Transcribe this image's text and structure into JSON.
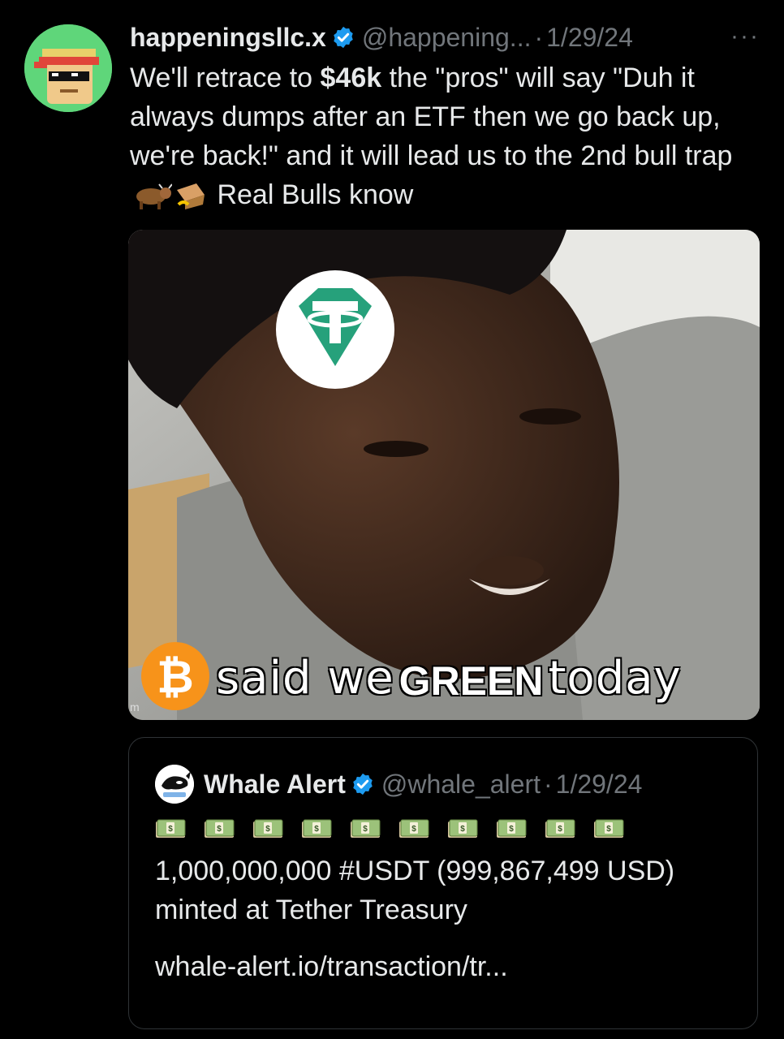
{
  "tweet": {
    "display_name": "happeningsllc.x",
    "handle": "@happening...",
    "dot": "·",
    "date": "1/29/24",
    "more": "···",
    "text_part1": "We'll retrace to ",
    "text_bold": "$46k",
    "text_part2": " the \"pros\" will say \"Duh it always dumps after an ETF then we go back up, we're back!\" and it will lead us to the 2nd bull trap ",
    "text_part3": " Real Bulls know",
    "emojis": [
      "cow-emoji",
      "box-emoji"
    ]
  },
  "media": {
    "caption_said": "said we",
    "caption_green": "GREEN",
    "caption_today": "today",
    "bitcoin_symbol": "₿",
    "tether_symbol": "₮",
    "watermark": "m"
  },
  "quote": {
    "display_name": "Whale Alert",
    "handle": "@whale_alert",
    "dot": "·",
    "date": "1/29/24",
    "bill_count": 10,
    "bill_icon": "money-bill-emoji",
    "text": "1,000,000,000 #USDT (999,867,499 USD) minted at Tether Treasury",
    "link": "whale-alert.io/transaction/tr..."
  },
  "colors": {
    "background": "#000000",
    "text": "#e7e9ea",
    "muted": "#71767b",
    "verified": "#1d9bf0",
    "border": "#2f3336",
    "tether": "#26a17b",
    "bitcoin": "#f7931a"
  }
}
